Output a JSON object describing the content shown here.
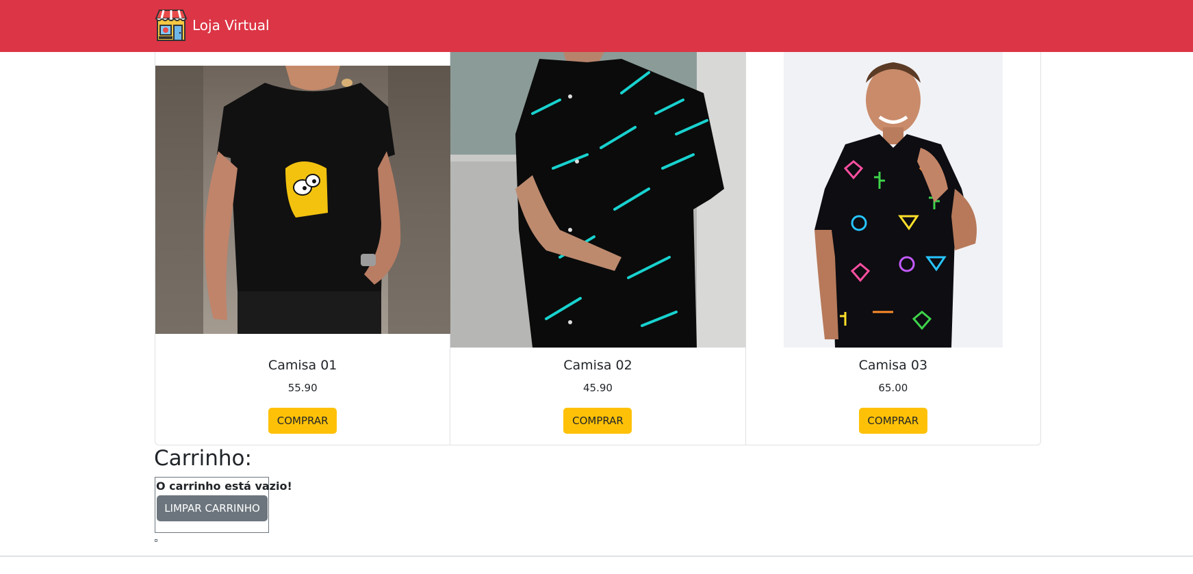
{
  "navbar": {
    "brand_text": "Loja Virtual",
    "brand_icon": "store-icon",
    "color": "#dc3545"
  },
  "products": [
    {
      "name": "Camisa 01",
      "price": "55.90",
      "button": "COMPRAR",
      "image": "black-simpsons-tshirt"
    },
    {
      "name": "Camisa 02",
      "price": "45.90",
      "button": "COMPRAR",
      "image": "black-cyan-striped-shirt"
    },
    {
      "name": "Camisa 03",
      "price": "65.00",
      "button": "COMPRAR",
      "image": "neon-print-shirt"
    }
  ],
  "cart": {
    "title": "Carrinho:",
    "empty_message": "O carrinho está vazio!",
    "clear_button": "LIMPAR CARRINHO"
  },
  "colors": {
    "buy_button": "#ffc107",
    "clear_button": "#6c757d"
  }
}
